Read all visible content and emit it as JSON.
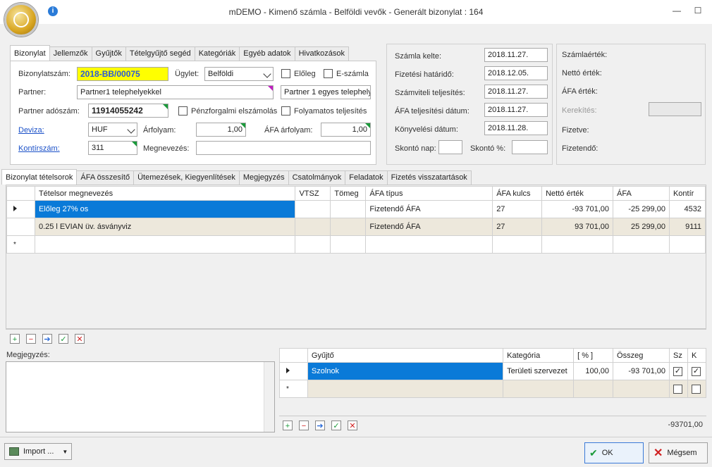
{
  "window": {
    "title": "mDEMO - Kimenő számla - Belföldi vevők - Generált bizonylat : 164",
    "minimize": "—",
    "maximize": "☐"
  },
  "top_tabs": [
    "Bizonylat",
    "Jellemzők",
    "Gyűjtők",
    "Tételgyűjtő segéd",
    "Kategóriák",
    "Egyéb adatok",
    "Hivatkozások"
  ],
  "form": {
    "bizonylatszam_label": "Bizonylatszám:",
    "bizonylatszam": "2018-BB/00075",
    "ugylet_label": "Ügylet:",
    "ugylet": "Belföldi",
    "eloleg_label": "Előleg",
    "eszamla_label": "E-számla",
    "partner_label": "Partner:",
    "partner": "Partner1 telephelyekkel",
    "partner_site": "Partner 1 egyes telephely",
    "adoszam_label": "Partner adószám:",
    "adoszam": "11914055242",
    "penzforgalmi_label": "Pénzforgalmi elszámolás",
    "folyamatos_label": "Folyamatos teljesítés",
    "deviza_label": "Deviza:",
    "deviza": "HUF",
    "arfolyam_label": "Árfolyam:",
    "arfolyam": "1,00",
    "afa_arfolyam_label": "ÁFA árfolyam:",
    "afa_arfolyam": "1,00",
    "kontirszam_label": "Kontírszám:",
    "kontirszam": "311",
    "megnevezes_label": "Megnevezés:",
    "megnevezes": ""
  },
  "dates": {
    "szamla_kelte_label": "Számla kelte:",
    "szamla_kelte": "2018.11.27.",
    "fizetesi_hatarido_label": "Fizetési határidő:",
    "fizetesi_hatarido": "2018.12.05.",
    "szamviteli_label": "Számviteli teljesítés:",
    "szamviteli": "2018.11.27.",
    "afa_teljesitesi_label": "ÁFA teljesítési dátum:",
    "afa_teljesitesi": "2018.11.27.",
    "konyvelesi_label": "Könyvelési dátum:",
    "konyvelesi": "2018.11.28.",
    "skonto_nap_label": "Skontó nap:",
    "skonto_pct_label": "Skontó %:"
  },
  "totals": {
    "szamlaertek_label": "Számlaérték:",
    "netto_label": "Nettó érték:",
    "afa_label": "ÁFA érték:",
    "kerekites_label": "Kerekítés:",
    "fizetve_label": "Fizetve:",
    "fizetendo_label": "Fizetendő:"
  },
  "lower_tabs": [
    "Bizonylat tételsorok",
    "ÁFA összesítő",
    "Ütemezések, Kiegyenlítések",
    "Megjegyzés",
    "Csatolmányok",
    "Feladatok",
    "Fizetés visszatartások"
  ],
  "items_grid": {
    "columns": [
      "Tételsor megnevezés",
      "VTSZ",
      "Tömeg",
      "ÁFA típus",
      "ÁFA kulcs",
      "Nettó érték",
      "ÁFA",
      "Kontír"
    ],
    "rows": [
      {
        "name": "Előleg 27% os",
        "vtsz": "",
        "tomeg": "",
        "afa_tipus": "Fizetendő ÁFA",
        "afa_kulcs": "27",
        "netto": "-93 701,00",
        "afa": "-25 299,00",
        "kontir": "4532"
      },
      {
        "name": "0.25 l EVIAN üv. ásványviz",
        "vtsz": "",
        "tomeg": "",
        "afa_tipus": "Fizetendő ÁFA",
        "afa_kulcs": "27",
        "netto": "93 701,00",
        "afa": "25 299,00",
        "kontir": "9111"
      }
    ],
    "new_row_marker": "*"
  },
  "megjegyzes_label": "Megjegyzés:",
  "collector_grid": {
    "columns": [
      "Gyűjtő",
      "Kategória",
      "[ % ]",
      "Összeg",
      "Sz",
      "K"
    ],
    "rows": [
      {
        "gyujto": "Szolnok",
        "kategoria": "Területi szervezet",
        "pct": "100,00",
        "osszeg": "-93 701,00",
        "sz": true,
        "k": true
      }
    ],
    "new_row_marker": "*",
    "total": "-93701,00"
  },
  "footer": {
    "import_label": "Import ...",
    "ok_label": "OK",
    "cancel_label": "Mégsem"
  },
  "colors": {
    "selection": "#0a7ad8",
    "highlight": "#ffff00",
    "link": "#1a50c8"
  }
}
